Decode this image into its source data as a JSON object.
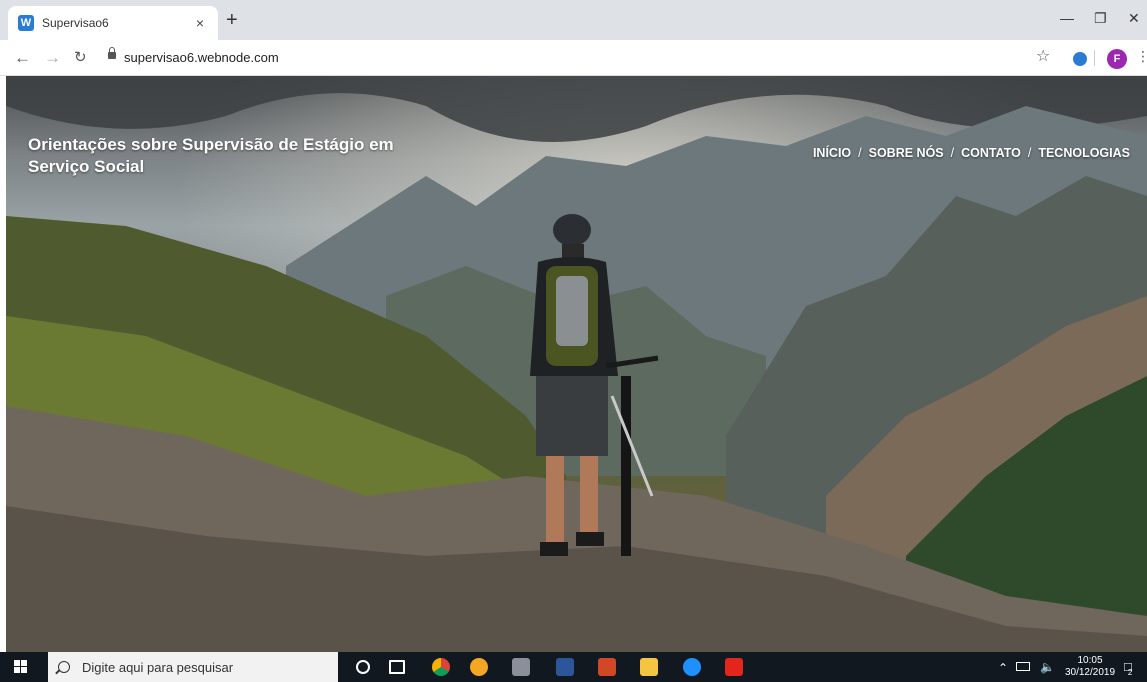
{
  "browser": {
    "tab_title": "Supervisao6",
    "tab_favicon": "W",
    "tab_close": "×",
    "new_tab": "+",
    "url": "supervisao6.webnode.com",
    "avatar_letter": "F"
  },
  "site": {
    "title": "Orientações sobre Supervisão de Estágio em Serviço Social",
    "nav": [
      {
        "label": "INÍCIO"
      },
      {
        "label": "SOBRE NÓS"
      },
      {
        "label": "CONTATO"
      },
      {
        "label": "TECNOLOGIAS"
      }
    ],
    "nav_separator": "/"
  },
  "taskbar": {
    "search_placeholder": "Digite aqui para pesquisar",
    "time": "10:05",
    "date": "30/12/2019",
    "notification_count": "2"
  },
  "colors": {
    "tab_strip": "#dee1e6",
    "taskbar": "#111820",
    "favicon": "#2a7bd3",
    "avatar": "#9c27b0"
  }
}
